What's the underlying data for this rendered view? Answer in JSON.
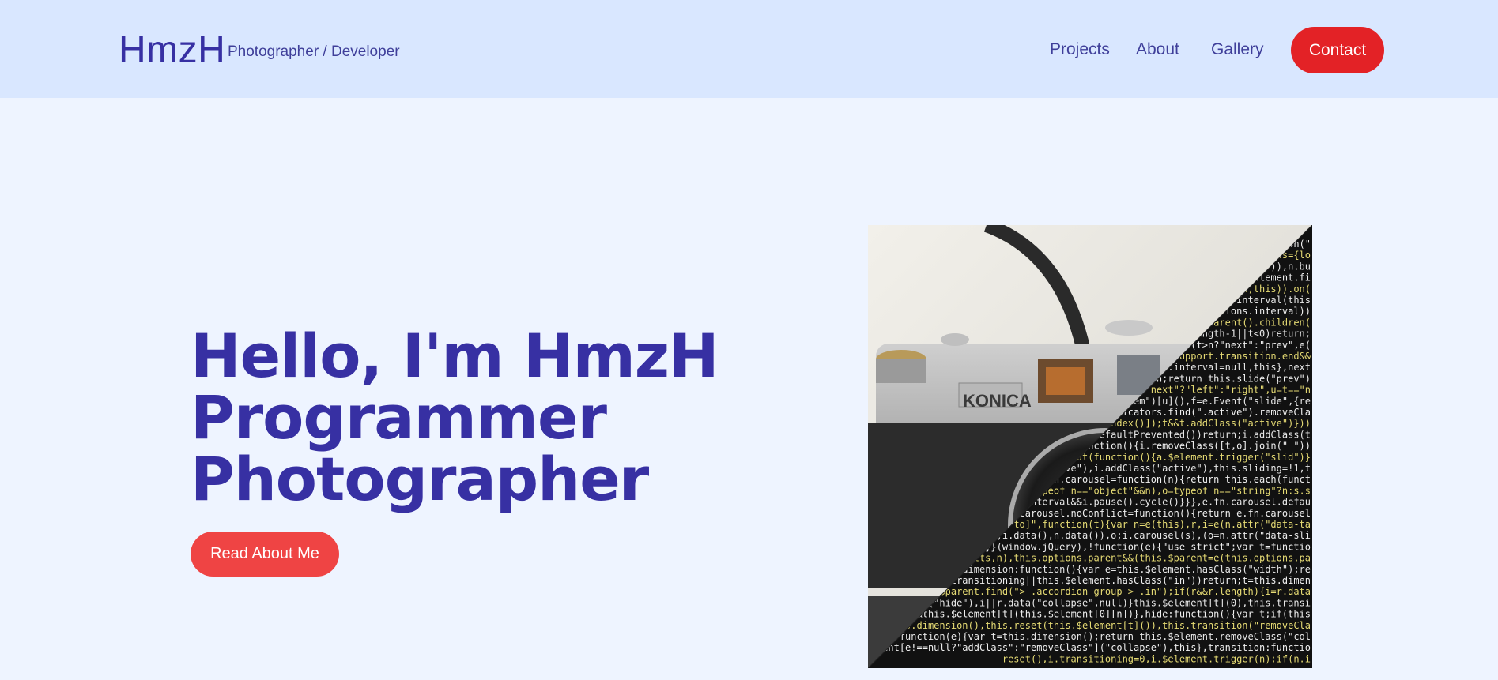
{
  "header": {
    "brand": "HmzH",
    "tagline": "Photographer / Developer",
    "nav": [
      "Projects",
      "About",
      "Gallery"
    ],
    "contact_label": "Contact"
  },
  "hero": {
    "lines": [
      "Hello, I'm HmzH",
      "Programmer",
      "Photographer"
    ],
    "button_label": "Read About Me",
    "image": {
      "camera_brand": "KONICA",
      "code_lines": [
        "ment.on(\"",
        "ults={lo",
        ".btn\")),n.bu",
        "is.$element.fi",
        "pause,this)).on(",
        "clearInterval(this",
        ".options.interval))",
        "ive.parent().children(",
        "s.length-1||t<0)return;",
        "slide(t>n?\"next\":\"prev\",e(",
        "n&&e.support.transition.end&&",
        "this.interval=null,this},next",
        "turn;return this.slide(\"prev\")",
        "t==\"next\"?\"left\":\"right\",u=t==\"n",
        ".item\")[u](),f=e.Event(\"slide\",{re",
        "$indicators.find(\".active\").removeCla",
        "iveIndex()]);t&&t.addClass(\"active\")}))",
        ".isDefaultPrevented())return;i.addClass(t",
        "d,function(){i.removeClass([t,o].join(\" \"))",
        "imeout(function(){a.$element.trigger(\"slid\")}",
        "active\"),i.addClass(\"active\"),this.sliding=!1,t",
        "e.fn.carousel=function(n){return this.each(funct",
        ",typeof n==\"object\"&&n),o=typeof n==\"string\"?n:s.s",
        "s.interval&&i.pause().cycle()}}},e.fn.carousel.defau",
        ".fn.carousel.noConflict=function(){return e.fn.carousel",
        "ide-to]\",function(t){var n=e(this),r,i=e(n.attr(\"data-ta",
        "{},i.data(),n.data()),o;i.carousel(s),(o=n.attr(\"data-sli",
        "}}(window.jQuery),!function(e){\"use strict\";var t=functio",
        "faults,n),this.options.parent&&(this.$parent=e(this.options.pa",
        "t,dimension:function(){var e=this.$element.hasClass(\"width\");re",
        "s.transitioning||this.$element.hasClass(\"in\"))return;t=this.dimen",
        "his.$parent.find(\"> .accordion-group > .in\");if(r&&r.length){i=r.data",
        "pse(\"hide\"),i||r.data(\"collapse\",null)}this.$element[t](0),this.transi",
        "on&&this.$element[t](this.$element[0][n])},hide:function(){var t;if(this",
        "this.dimension(),this.reset(this.$element[t]()),this.transition(\"removeCla",
        "et:function(e){var t=this.dimension();return this.$element.removeClass(\"col",
        "ement[e!==null?\"addClass\":\"removeClass\"](\"collapse\"),this},transition:functio",
        "reset(),i.transitioning=0,i.$element.trigger(n);if(n.i"
      ]
    }
  },
  "colors": {
    "header_bg": "#d9e7ff",
    "page_bg": "#eef4ff",
    "primary_text": "#3730a3",
    "contact_bg": "#e32226",
    "button_bg": "#ef4444",
    "code_keyword": "#f92672",
    "code_string": "#e6db74",
    "code_number": "#ae81ff"
  }
}
